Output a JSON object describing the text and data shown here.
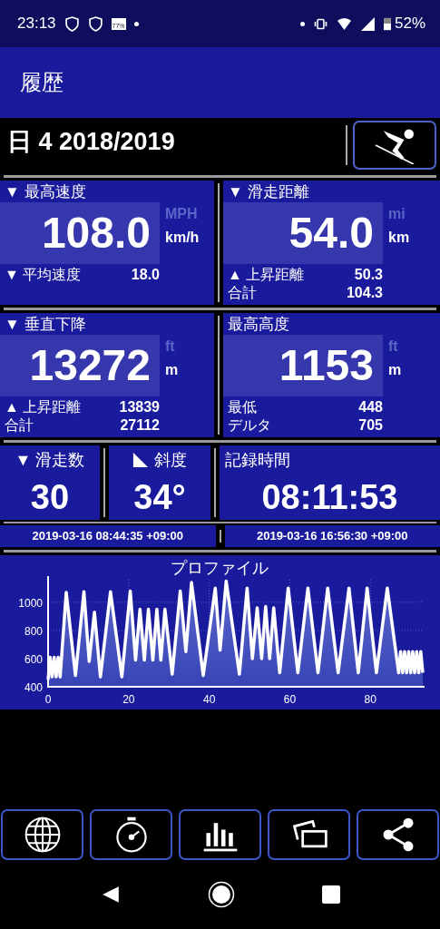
{
  "status_bar": {
    "time": "23:13",
    "notification_badge": "77%",
    "battery": "52%"
  },
  "app_bar": {
    "title": "履歴"
  },
  "header": {
    "title": "日 4 2018/2019"
  },
  "stats": [
    {
      "label": "▼ 最高速度",
      "value": "108.0",
      "units": [
        {
          "label": "MPH",
          "selected": false
        },
        {
          "label": "km/h",
          "selected": true
        }
      ],
      "rows": [
        {
          "label": "▼ 平均速度",
          "value": "18.0"
        }
      ]
    },
    {
      "label": "▼ 滑走距離",
      "value": "54.0",
      "units": [
        {
          "label": "mi",
          "selected": false
        },
        {
          "label": "km",
          "selected": true
        }
      ],
      "rows": [
        {
          "label": "▲ 上昇距離",
          "value": "50.3"
        },
        {
          "label": "合計",
          "value": "104.3"
        }
      ]
    },
    {
      "label": "▼ 垂直下降",
      "value": "13272",
      "units": [
        {
          "label": "ft",
          "selected": false
        },
        {
          "label": "m",
          "selected": true
        }
      ],
      "rows": [
        {
          "label": "▲ 上昇距離",
          "value": "13839"
        },
        {
          "label": "合計",
          "value": "27112"
        }
      ]
    },
    {
      "label": "最高高度",
      "value": "1153",
      "units": [
        {
          "label": "ft",
          "selected": false
        },
        {
          "label": "m",
          "selected": true
        }
      ],
      "rows": [
        {
          "label": "最低",
          "value": "448"
        },
        {
          "label": "デルタ",
          "value": "705"
        }
      ]
    }
  ],
  "counters": [
    {
      "kind": "plain",
      "label": "▼ 滑走数",
      "value": "30"
    },
    {
      "kind": "slope",
      "label": "斜度",
      "value": "34°"
    },
    {
      "kind": "plain",
      "label": "記録時間",
      "value": "08:11:53"
    }
  ],
  "timestamps": [
    "2019-03-16 08:44:35 +09:00",
    "2019-03-16 16:56:30 +09:00"
  ],
  "profile": {
    "chart_data": {
      "type": "area",
      "grid": true,
      "title": "プロファイル",
      "xlim": [
        0,
        93
      ],
      "ylim": [
        400,
        1160
      ],
      "xticks": [
        0,
        20,
        40,
        60,
        80
      ],
      "yticks": [
        400,
        600,
        800,
        1000
      ],
      "x": [
        0,
        0.5,
        1,
        1.5,
        2,
        2.5,
        3,
        4.5,
        6.8,
        8.9,
        10.2,
        11.5,
        13,
        15.5,
        18.3,
        20.4,
        21.7,
        22.8,
        23.9,
        24.9,
        26,
        27,
        28,
        29,
        30.8,
        32.8,
        34.2,
        35.6,
        38.5,
        41.5,
        42.7,
        44.2,
        47.5,
        49.4,
        50.7,
        51.9,
        53,
        54,
        55,
        56,
        57.5,
        59.6,
        62,
        64.5,
        67,
        69.4,
        72,
        74.7,
        77,
        79.2,
        81.5,
        84.2,
        87,
        87.5,
        88,
        88.5,
        89,
        89.5,
        90,
        90.5,
        91,
        91.5,
        92,
        92.5,
        93
      ],
      "series": [
        {
          "color": "#ffffff",
          "values": [
            450,
            610,
            470,
            610,
            470,
            610,
            470,
            1070,
            480,
            1075,
            580,
            930,
            470,
            1075,
            470,
            1080,
            590,
            950,
            590,
            950,
            590,
            950,
            590,
            950,
            490,
            1080,
            650,
            1140,
            480,
            1100,
            660,
            1150,
            490,
            1100,
            600,
            960,
            600,
            970,
            600,
            960,
            500,
            1100,
            500,
            1100,
            500,
            1100,
            500,
            1100,
            500,
            1100,
            500,
            1100,
            500,
            650,
            500,
            650,
            500,
            650,
            500,
            650,
            500,
            650,
            500,
            650,
            500
          ]
        }
      ]
    }
  }
}
